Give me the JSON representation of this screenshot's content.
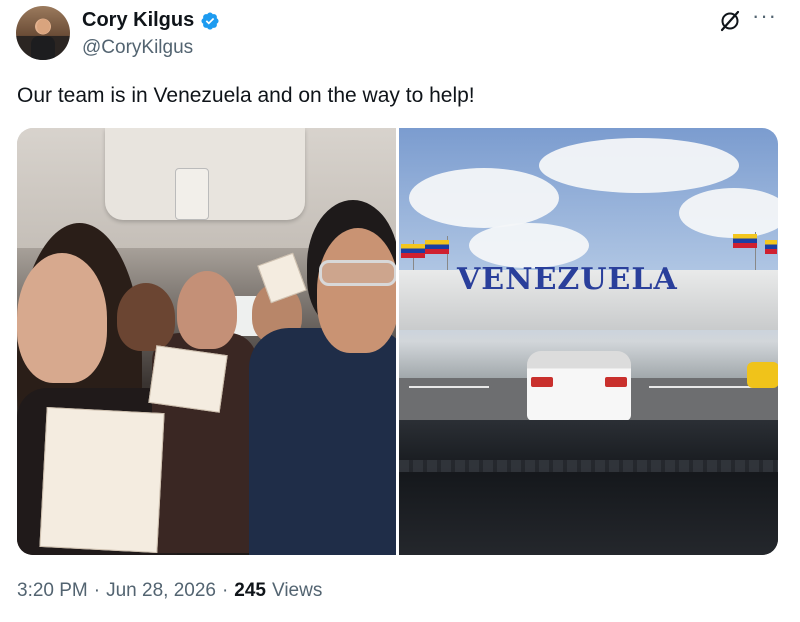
{
  "author": {
    "display_name": "Cory Kilgus",
    "handle": "@CoryKilgus",
    "verified": true
  },
  "tweet": {
    "text": "Our team is in Venezuela and on the way to help!",
    "time": "3:20 PM",
    "separator": "·",
    "date": "Jun 28, 2026",
    "views_count": "245",
    "views_label": "Views"
  },
  "media": {
    "photo_right_sign_text": "VENEZUELA"
  },
  "icons": {
    "verified": "verified-badge-icon",
    "grok": "grok-icon",
    "more": "more-options-icon"
  },
  "colors": {
    "verified_blue": "#1d9bf0",
    "text_primary": "#0f1419",
    "text_secondary": "#536471"
  }
}
